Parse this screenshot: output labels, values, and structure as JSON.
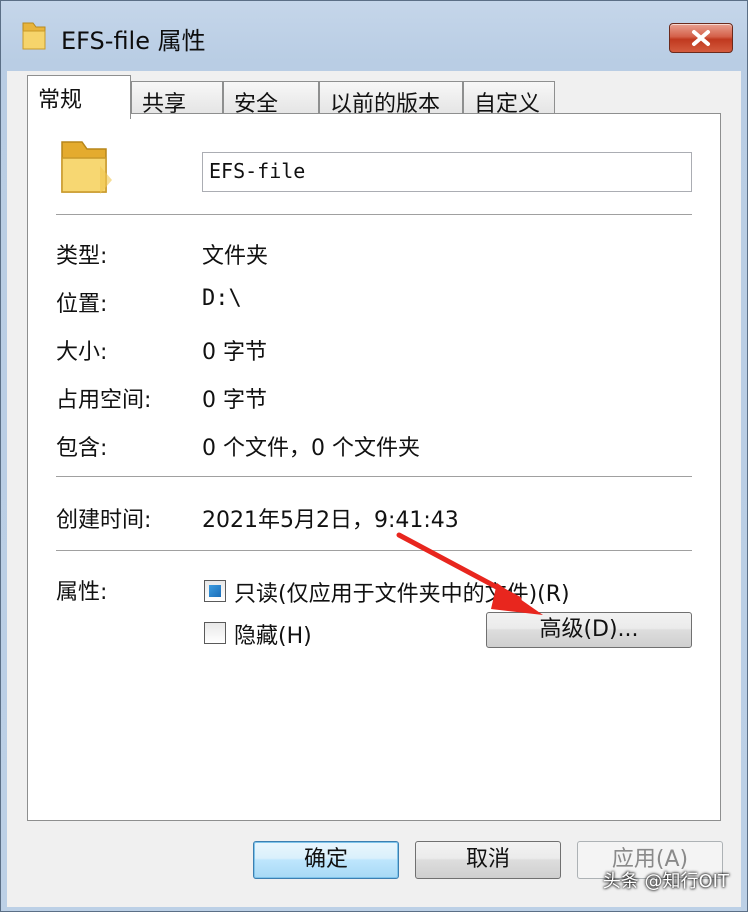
{
  "window": {
    "title": "EFS-file 属性"
  },
  "tabs": [
    {
      "label": "常规"
    },
    {
      "label": "共享"
    },
    {
      "label": "安全"
    },
    {
      "label": "以前的版本"
    },
    {
      "label": "自定义"
    }
  ],
  "general": {
    "name_value": "EFS-file",
    "type_label": "类型:",
    "type_value": "文件夹",
    "location_label": "位置:",
    "location_value": "D:\\",
    "size_label": "大小:",
    "size_value": "0 字节",
    "disk_size_label": "占用空间:",
    "disk_size_value": "0 字节",
    "contains_label": "包含:",
    "contains_value": "0 个文件，0 个文件夹",
    "created_label": "创建时间:",
    "created_value": "2021年5月2日，9:41:43",
    "attributes_label": "属性:",
    "readonly_label": "只读(仅应用于文件夹中的文件)(R)",
    "hidden_label": "隐藏(H)",
    "advanced_label": "高级(D)..."
  },
  "buttons": {
    "ok": "确定",
    "cancel": "取消",
    "apply": "应用(A)"
  },
  "watermark": "头条 @知行OIT",
  "colors": {
    "arrow": "#e8261e",
    "close_button": "#c7432a"
  },
  "icons": {
    "title": "folder-icon",
    "big": "folder-icon",
    "close": "close-icon"
  }
}
